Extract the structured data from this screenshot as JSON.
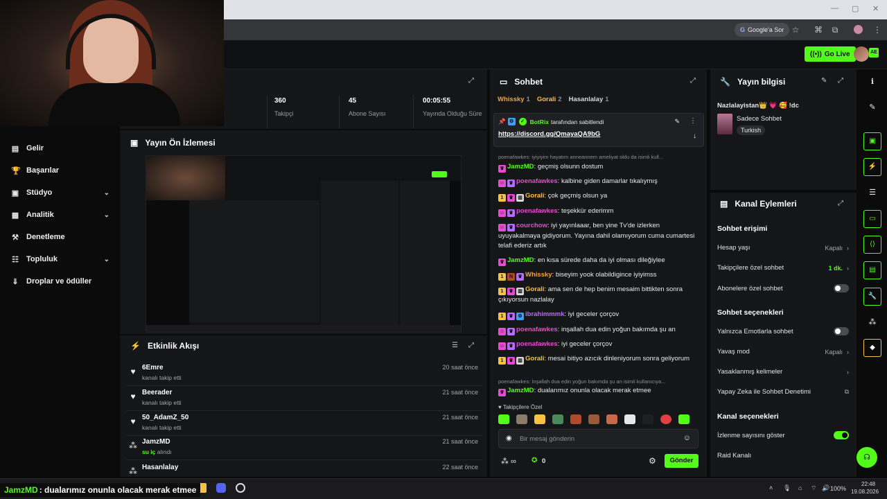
{
  "browser": {
    "google_ask": "Google'a Sor"
  },
  "header": {
    "go_live": "Go Live",
    "avatar_badge": "AE"
  },
  "nav": [
    {
      "label": "Gelir",
      "icon": "wallet-icon",
      "glyph": "▤"
    },
    {
      "label": "Başarılar",
      "icon": "trophy-icon",
      "glyph": "🏆"
    },
    {
      "label": "Stüdyo",
      "icon": "studio-icon",
      "glyph": "▣",
      "chevron": "⌄"
    },
    {
      "label": "Analitik",
      "icon": "analytics-icon",
      "glyph": "▦",
      "chevron": "⌄"
    },
    {
      "label": "Denetleme",
      "icon": "hammer-icon",
      "glyph": "⚒"
    },
    {
      "label": "Topluluk",
      "icon": "community-icon",
      "glyph": "☷",
      "chevron": "⌄"
    },
    {
      "label": "Droplar ve ödüller",
      "icon": "drops-icon",
      "glyph": "⇓"
    }
  ],
  "stats": [
    {
      "value": "360",
      "label": "Takipçi"
    },
    {
      "value": "45",
      "label": "Abone Sayısı"
    },
    {
      "value": "00:05:55",
      "label": "Yayında Olduğu Süre"
    }
  ],
  "preview": {
    "title": "Yayın Ön İzlemesi"
  },
  "activity": {
    "title": "Etkinlik Akışı",
    "items": [
      {
        "name": "6Emre",
        "desc": "kanalı takip etti",
        "time": "20 saat önce"
      },
      {
        "name": "Beerader",
        "desc": "kanalı takip etti",
        "time": "21 saat önce"
      },
      {
        "name": "50_AdamZ_50",
        "desc": "kanalı takip etti",
        "time": "21 saat önce"
      },
      {
        "name": "JamzMD",
        "desc_prefix": "su iç",
        "desc": " alındı",
        "time": "21 saat önce"
      },
      {
        "name": "Hasanlalay",
        "desc": "",
        "time": "22 saat önce"
      }
    ]
  },
  "chat": {
    "title": "Sohbet",
    "top_badges": [
      {
        "name": "Whissky",
        "count": "1",
        "color": "#f4a338"
      },
      {
        "name": "Gorali",
        "count": "2",
        "color": "#f6c244"
      },
      {
        "name": "Hasanlalay",
        "count": "1",
        "color": "#d9d9d9"
      }
    ],
    "pinned": {
      "by_user": "BotRix",
      "by_suffix": " tarafından sabitlendi",
      "link": "https://discord.gg/QmayaQA9bG"
    },
    "messages": [
      {
        "reply": "poenafawkes: iyiyiyim hayatım anneannem ameliyat oldu da isimli kull..."
      },
      {
        "user": "JamzMD",
        "color": "#53fc18",
        "text": "geçmiş olsunn dostum"
      },
      {
        "user": "poenafawkes",
        "color": "#e64bd1",
        "text": "kalbine giden damarlar tıkalıymış"
      },
      {
        "user": "Gorali",
        "color": "#f6c244",
        "text": "çok geçmiş olsun ya"
      },
      {
        "user": "poenafawkes",
        "color": "#e64bd1",
        "text": "teşekkür ederimm"
      },
      {
        "user": "courchow",
        "color": "#e64bd1",
        "text": "iyi yayınlaaar, ben yine Tv'de izlerken uyuyakalmaya gidiyorum. Yayına dahil olamıyorum cuma cumartesi telafi ederiz artık"
      },
      {
        "user": "JamzMD",
        "color": "#53fc18",
        "text": "en kısa sürede daha da iyi olması dileğiylee"
      },
      {
        "user": "Whissky",
        "color": "#f4a338",
        "text": "biseyim yook olabildigince iyiyimss"
      },
      {
        "user": "Gorali",
        "color": "#f6c244",
        "text": "ama sen de hep benim mesaim bittikten sonra çıkıyorsun nazlalay"
      },
      {
        "user": "ibrahimmmk",
        "color": "#b56cff",
        "text": "iyi geceler çorçov"
      },
      {
        "user": "poenafawkes",
        "color": "#e64bd1",
        "text": "inşallah dua edin yoğun bakımda şu an"
      },
      {
        "user": "poenafawkes",
        "color": "#e64bd1",
        "text": "iyi geceler çorçov"
      },
      {
        "user": "Gorali",
        "color": "#f6c244",
        "text": "mesai bitiyo azıcık dinleniyorum sonra geliyorum"
      },
      {
        "reply": "poenafawkes: İnşallah dua edin yoğun bakımda şu an isimli kullanıcıya..."
      },
      {
        "user": "JamzMD",
        "color": "#53fc18",
        "text": "dualarımız onunla olacak merak etmee"
      }
    ],
    "followers_only": "Takipçilere Özel",
    "input_placeholder": "Bir mesaj gönderin",
    "points": "0",
    "send": "Gönder"
  },
  "stream_info": {
    "title": "Yayın bilgisi",
    "stream_title": "Nazlalayistan👑 💗 🥰 !dc",
    "category": "Sadece Sohbet",
    "tag": "Turkish"
  },
  "channel_actions": {
    "title": "Kanal Eylemleri",
    "chat_access_heading": "Sohbet erişimi",
    "account_age": "Hesap yaşı",
    "account_age_value": "Kapalı",
    "followers_chat": "Takipçilere özel sohbet",
    "followers_chat_value": "1 dk.",
    "subs_chat": "Abonelere özel sohbet",
    "chat_options_heading": "Sohbet seçenekleri",
    "emote_only": "Yalnızca Emotlarla sohbet",
    "slow_mode": "Yavaş mod",
    "slow_mode_value": "Kapalı",
    "banned_words": "Yasaklanmış kelimeler",
    "ai_moderation": "Yapay Zeka ile Sohbet Denetimi",
    "channel_options_heading": "Kanal seçenekleri",
    "show_viewers": "İzlenme sayısını göster",
    "raid": "Raid Kanalı"
  },
  "overlay_chat": {
    "user": "JamzMD",
    "text": ": dualarımız onunla olacak merak etmee"
  },
  "tray": {
    "battery": "100%",
    "time": "22:48",
    "date": "19.08.2026"
  },
  "colors": {
    "accent": "#53fc18",
    "panel": "#151618",
    "bg": "#0a0a0a"
  }
}
